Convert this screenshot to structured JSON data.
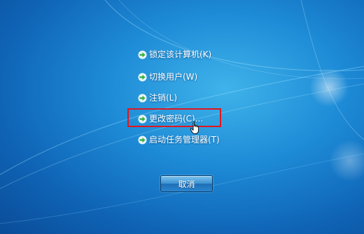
{
  "menu": {
    "items": [
      {
        "label": "锁定该计算机(K)",
        "icon": "green-arrow-icon"
      },
      {
        "label": "切换用户(W)",
        "icon": "green-arrow-icon"
      },
      {
        "label": "注销(L)",
        "icon": "green-arrow-icon"
      },
      {
        "label": "更改密码(C)...",
        "icon": "green-arrow-icon"
      },
      {
        "label": "启动任务管理器(T)",
        "icon": "green-arrow-icon"
      }
    ]
  },
  "cancel_button": {
    "label": "取消"
  },
  "colors": {
    "highlight_border": "#e0171f",
    "arrow_green": "#3cb043",
    "background": "#1d8ad6"
  }
}
